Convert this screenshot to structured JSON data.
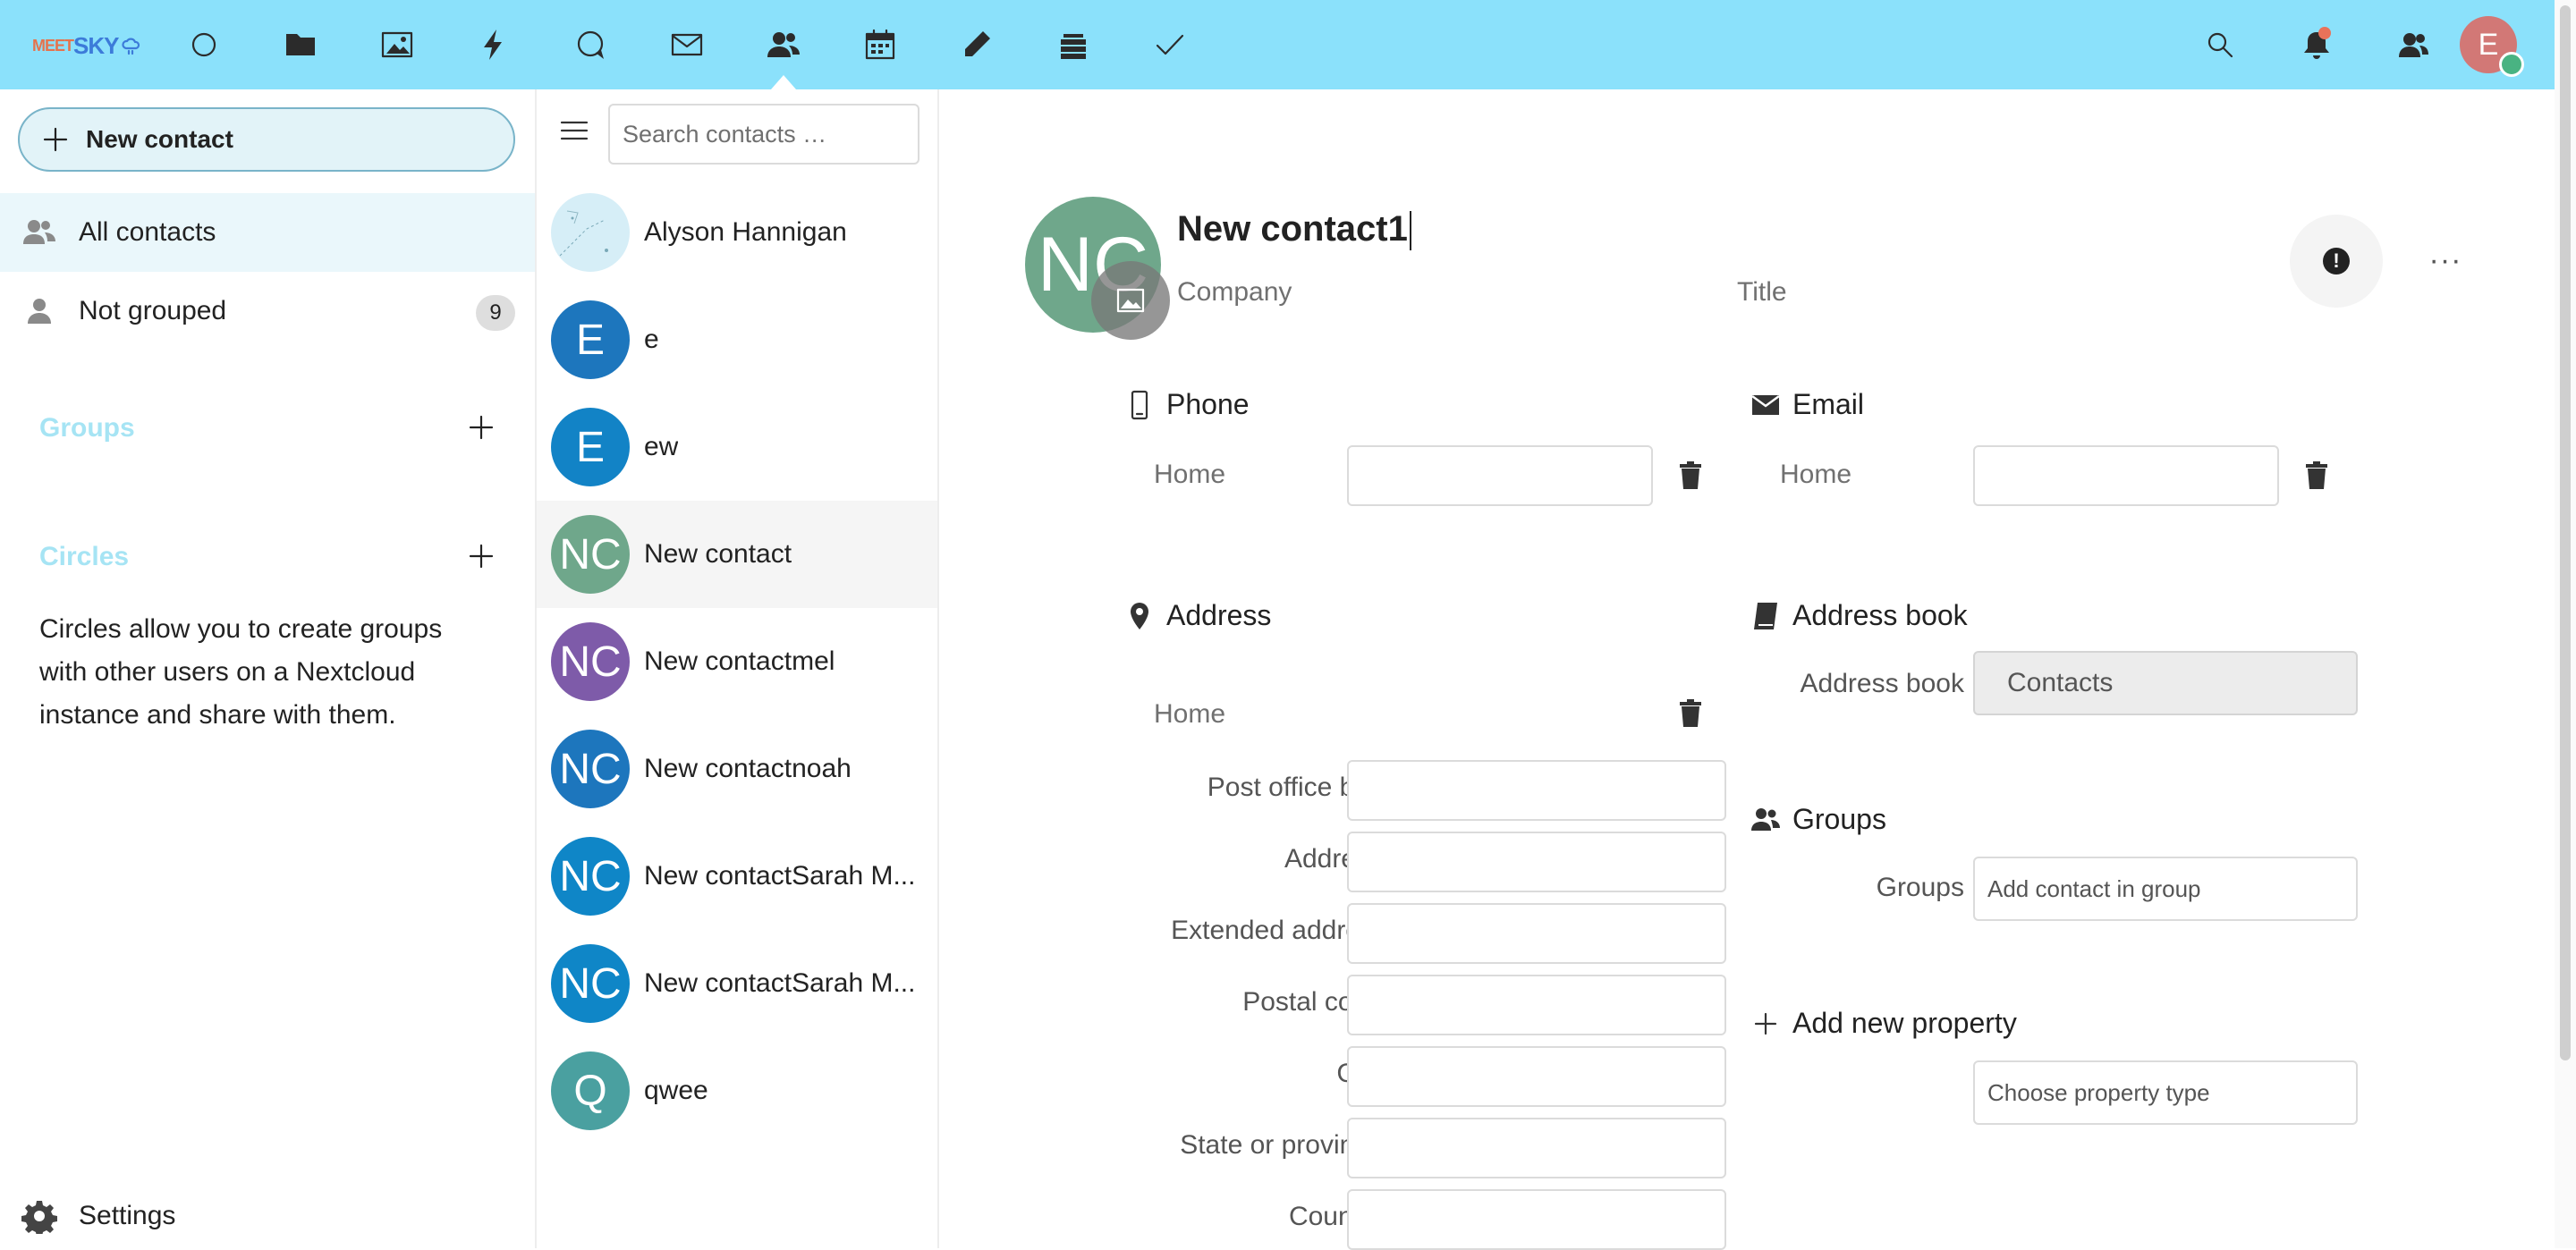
{
  "header": {
    "logo": {
      "part1": "MEET",
      "part2": "SKY"
    },
    "apps": [
      {
        "name": "dashboard",
        "icon": "circle-icon"
      },
      {
        "name": "files",
        "icon": "folder-icon"
      },
      {
        "name": "photos",
        "icon": "image-icon"
      },
      {
        "name": "activity",
        "icon": "lightning-icon"
      },
      {
        "name": "talk",
        "icon": "chat-icon"
      },
      {
        "name": "mail",
        "icon": "envelope-icon"
      },
      {
        "name": "contacts",
        "icon": "contacts-icon",
        "active": true
      },
      {
        "name": "calendar",
        "icon": "calendar-icon"
      },
      {
        "name": "notes",
        "icon": "pencil-icon"
      },
      {
        "name": "deck",
        "icon": "stack-icon"
      },
      {
        "name": "tasks",
        "icon": "checkmark-icon"
      }
    ],
    "user_initial": "E",
    "colors": {
      "header_bg": "#8be1fb",
      "avatar": "#d27876",
      "status": "#49b382"
    }
  },
  "nav": {
    "new_contact_label": "New contact",
    "all_contacts_label": "All contacts",
    "not_grouped_label": "Not grouped",
    "not_grouped_count": "9",
    "groups_caption": "Groups",
    "circles_caption": "Circles",
    "circles_description": "Circles allow you to create groups with other users on a Nextcloud instance and share with them.",
    "settings_label": "Settings"
  },
  "list": {
    "search_placeholder": "Search contacts …",
    "contacts": [
      {
        "initials": "",
        "name": "Alyson Hannigan",
        "color": "#d6eef7",
        "has_photo": true
      },
      {
        "initials": "E",
        "name": "e",
        "color": "#1d76bd"
      },
      {
        "initials": "E",
        "name": "ew",
        "color": "#1283c6"
      },
      {
        "initials": "NC",
        "name": "New contact",
        "color": "#6fa78b",
        "selected": true
      },
      {
        "initials": "NC",
        "name": "New contactmel",
        "color": "#7e5ba9"
      },
      {
        "initials": "NC",
        "name": "New contactnoah",
        "color": "#1d76bd"
      },
      {
        "initials": "NC",
        "name": "New contactSarah M...",
        "color": "#0f86c7"
      },
      {
        "initials": "NC",
        "name": "New contactSarah M...",
        "color": "#0f86c7"
      },
      {
        "initials": "Q",
        "name": "qwee",
        "color": "#4aa0a0"
      }
    ]
  },
  "detail": {
    "initials": "NC",
    "name": "New contact1",
    "company_placeholder": "Company",
    "title_placeholder": "Title",
    "phone": {
      "header": "Phone",
      "type": "Home"
    },
    "email": {
      "header": "Email",
      "type": "Home"
    },
    "address": {
      "header": "Address",
      "type": "Home",
      "fields": [
        "Post office box",
        "Address",
        "Extended addre...",
        "Postal code",
        "City",
        "State or province",
        "Country"
      ]
    },
    "addressbook": {
      "header": "Address book",
      "label": "Address book",
      "value": "Contacts"
    },
    "groups": {
      "header": "Groups",
      "label": "Groups",
      "placeholder": "Add contact in group"
    },
    "add_property": {
      "label": "Add new property",
      "placeholder": "Choose property type"
    }
  }
}
